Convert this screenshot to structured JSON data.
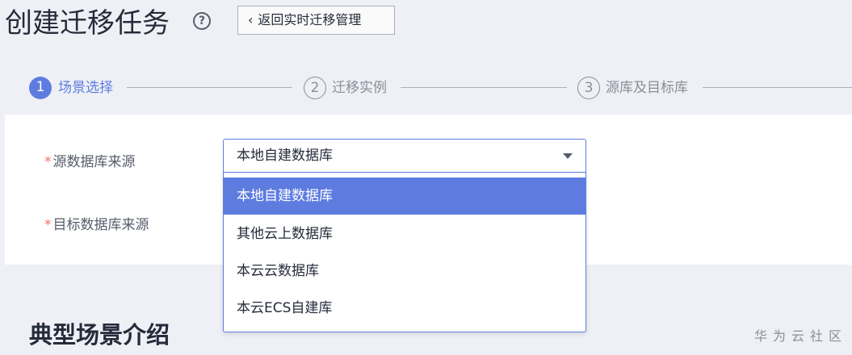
{
  "header": {
    "title": "创建迁移任务",
    "help_icon": "question-circle-icon",
    "back_label": "返回实时迁移管理"
  },
  "stepper": {
    "steps": [
      {
        "number": "1",
        "label": "场景选择",
        "active": true
      },
      {
        "number": "2",
        "label": "迁移实例",
        "active": false
      },
      {
        "number": "3",
        "label": "源库及目标库",
        "active": false
      }
    ]
  },
  "form": {
    "source_label": "源数据库来源",
    "target_label": "目标数据库来源",
    "required_mark": "*",
    "source_value": "本地自建数据库"
  },
  "dropdown": {
    "options": [
      "本地自建数据库",
      "其他云上数据库",
      "本云云数据库",
      "本云ECS自建库"
    ],
    "selected_index": 0
  },
  "section": {
    "title": "典型场景介绍"
  },
  "watermark": "华为云社区",
  "colors": {
    "accent": "#5e7ce0",
    "required": "#f66f6a",
    "page_bg": "#eef0f5"
  }
}
